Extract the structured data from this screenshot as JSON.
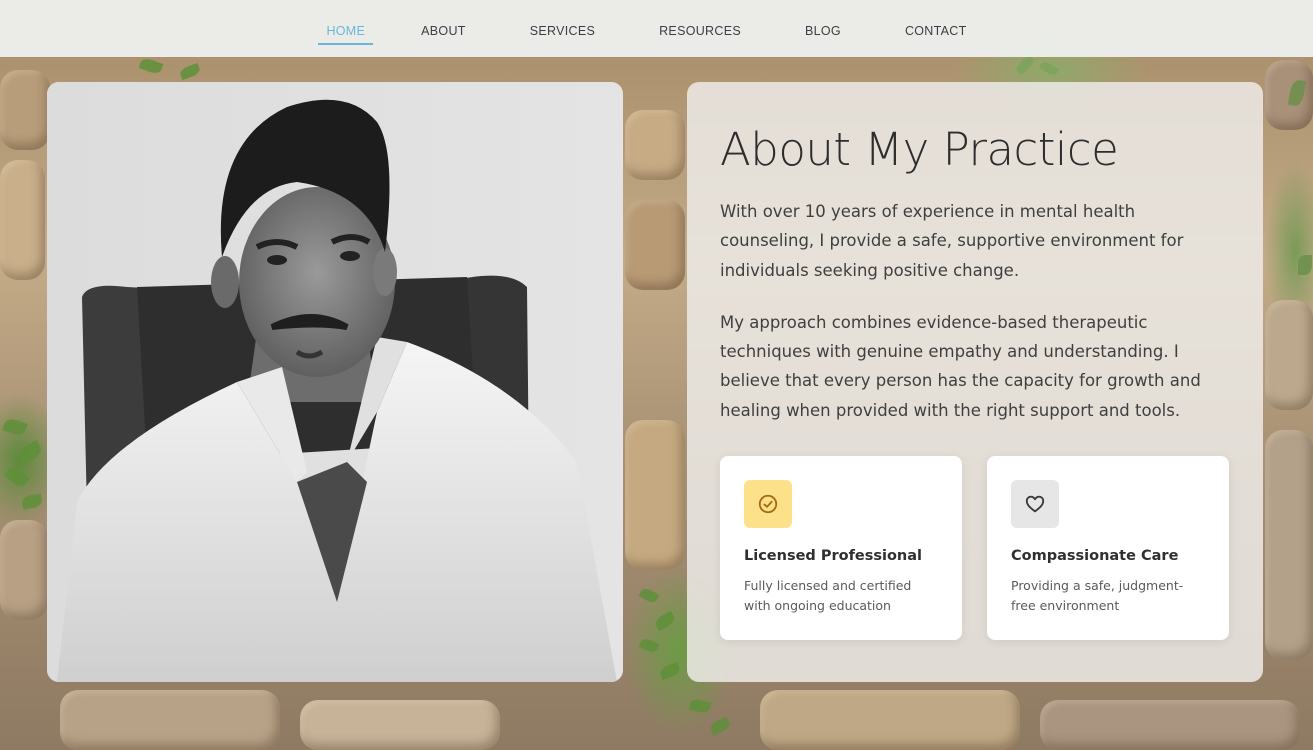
{
  "nav": {
    "items": [
      {
        "label": "HOME",
        "active": true
      },
      {
        "label": "ABOUT",
        "active": false
      },
      {
        "label": "SERVICES",
        "active": false
      },
      {
        "label": "RESOURCES",
        "active": false
      },
      {
        "label": "BLOG",
        "active": false
      },
      {
        "label": "CONTACT",
        "active": false
      }
    ],
    "active_color": "#6bb7d8"
  },
  "about": {
    "title": "About My Practice",
    "paragraph1": "With over 10 years of experience in mental health counseling, I provide a safe, supportive environment for individuals seeking positive change.",
    "paragraph2": "My approach combines evidence-based therapeutic techniques with genuine empathy and understanding. I believe that every person has the capacity for growth and healing when provided with the right support and tools.",
    "features": [
      {
        "icon": "check-circle-icon",
        "icon_bg": "#fde08a",
        "title": "Licensed Professional",
        "description": "Fully licensed and certified with ongoing education"
      },
      {
        "icon": "heart-icon",
        "icon_bg": "#e6e6e6",
        "title": "Compassionate Care",
        "description": "Providing a safe, judgment-free environment"
      }
    ]
  },
  "photo": {
    "subject": "therapist-portrait",
    "style": "black-and-white"
  }
}
